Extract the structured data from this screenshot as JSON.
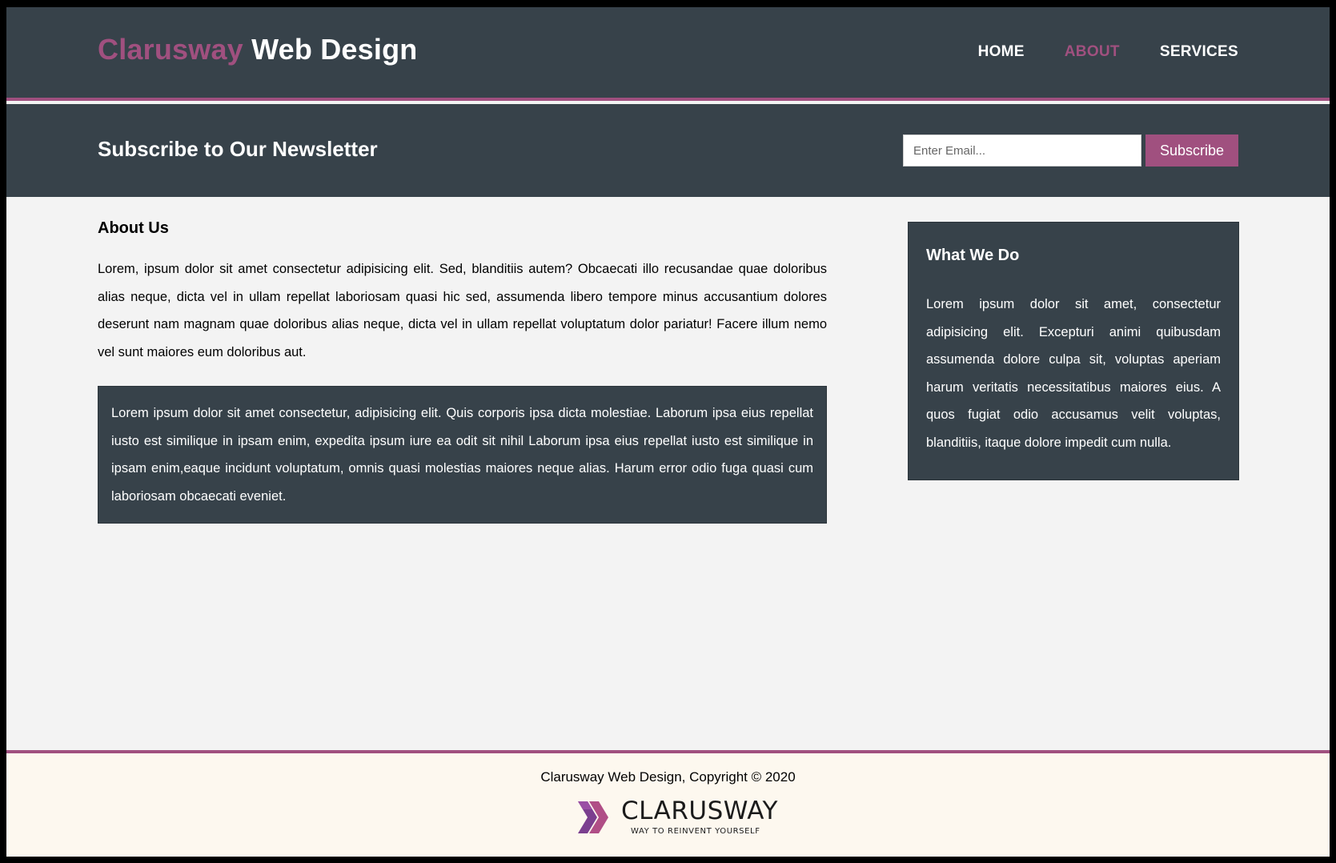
{
  "header": {
    "logo_accent": "Clarusway",
    "logo_rest": " Web Design",
    "nav": [
      {
        "label": "HOME",
        "active": false
      },
      {
        "label": "ABOUT",
        "active": true
      },
      {
        "label": "SERVICES",
        "active": false
      }
    ]
  },
  "newsletter": {
    "title": "Subscribe to Our Newsletter",
    "email_placeholder": "Enter Email...",
    "email_value": "",
    "subscribe_label": "Subscribe"
  },
  "about": {
    "title": "About Us",
    "lead": "Lorem, ipsum dolor sit amet consectetur adipisicing elit. Sed, blanditiis autem? Obcaecati illo recusandae quae doloribus alias neque, dicta vel in ullam repellat laboriosam quasi hic sed, assumenda libero tempore minus accusantium dolores deserunt nam magnam quae doloribus alias neque, dicta vel in ullam repellat voluptatum dolor pariatur! Facere illum nemo vel sunt maiores eum doloribus aut.",
    "box_text": "Lorem ipsum dolor sit amet consectetur, adipisicing elit. Quis corporis ipsa dicta molestiae. Laborum ipsa eius repellat iusto est similique in ipsam enim, expedita ipsum iure ea odit sit nihil Laborum ipsa eius repellat iusto est similique in ipsam enim,eaque incidunt voluptatum, omnis quasi molestias maiores neque alias. Harum error odio fuga quasi cum laboriosam obcaecati eveniet."
  },
  "sidebar": {
    "title": "What We Do",
    "text": "Lorem ipsum dolor sit amet, consectetur adipisicing elit. Excepturi animi quibusdam assumenda dolore culpa sit, voluptas aperiam harum veritatis necessitatibus maiores eius. A quos fugiat odio accusamus velit voluptas, blanditiis, itaque dolore impedit cum nulla."
  },
  "footer": {
    "copyright": "Clarusway Web Design, Copyright © 2020",
    "brand_name": "CLARUSWAY",
    "brand_tagline": "WAY TO REINVENT YOURSELF"
  },
  "colors": {
    "accent": "#a0507f",
    "dark": "#37424a",
    "page_bg": "#f3f3f3",
    "footer_bg": "#fdf8ef"
  }
}
